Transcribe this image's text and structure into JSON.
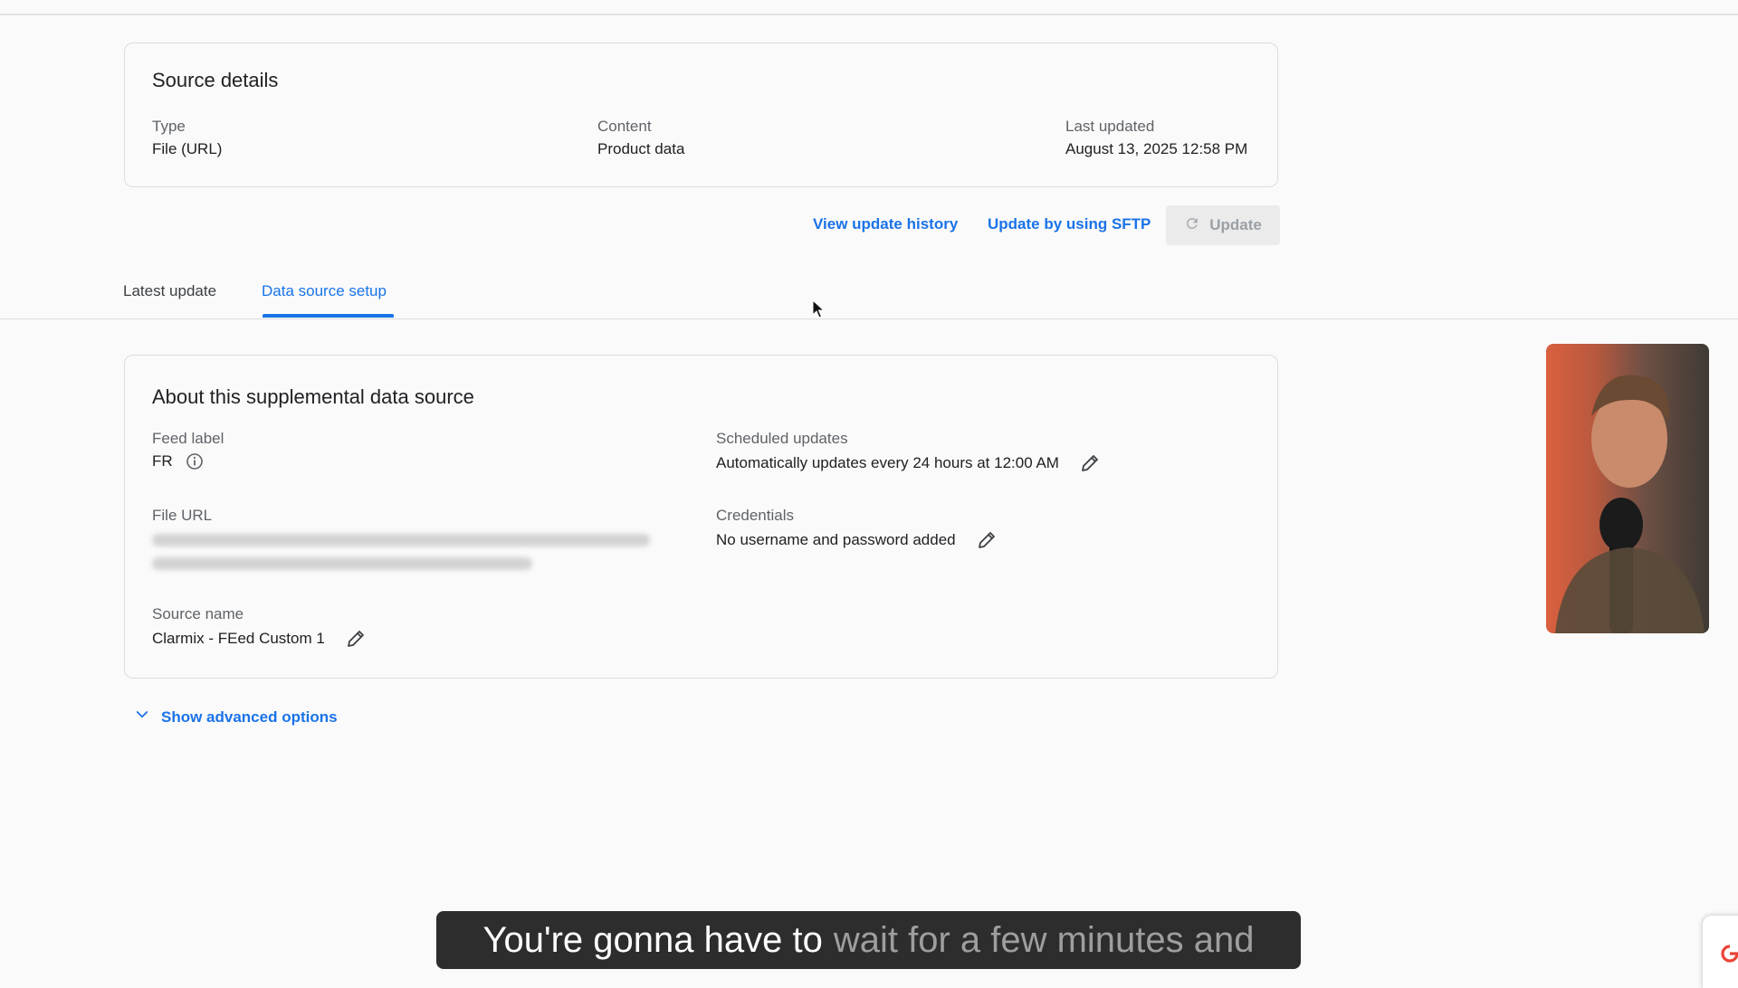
{
  "source_details": {
    "title": "Source details",
    "type_label": "Type",
    "type_value": "File (URL)",
    "content_label": "Content",
    "content_value": "Product data",
    "last_updated_label": "Last updated",
    "last_updated_value": "August 13, 2025 12:58 PM"
  },
  "actions": {
    "view_history": "View update history",
    "update_sftp": "Update by using SFTP",
    "update": "Update"
  },
  "tabs": [
    {
      "label": "Latest update",
      "active": false
    },
    {
      "label": "Data source setup",
      "active": true
    }
  ],
  "about": {
    "title": "About this supplemental data source",
    "feed_label_label": "Feed label",
    "feed_label_value": "FR",
    "scheduled_label": "Scheduled updates",
    "scheduled_value": "Automatically updates every 24 hours at 12:00 AM",
    "file_url_label": "File URL",
    "credentials_label": "Credentials",
    "credentials_value": "No username and password added",
    "source_name_label": "Source name",
    "source_name_value": "Clarmix - FEed Custom 1"
  },
  "advanced": {
    "label": "Show advanced options"
  },
  "caption": {
    "spoken": "You're gonna have to",
    "pending": "wait for a few minutes and"
  },
  "colors": {
    "accent": "#1a73e8",
    "text": "#202124",
    "muted": "#5f6368",
    "border": "#dadce0",
    "background": "#fafafa"
  },
  "icons": [
    "info-icon",
    "pencil-icon",
    "refresh-icon",
    "chevron-down-icon",
    "mouse-cursor-icon"
  ]
}
